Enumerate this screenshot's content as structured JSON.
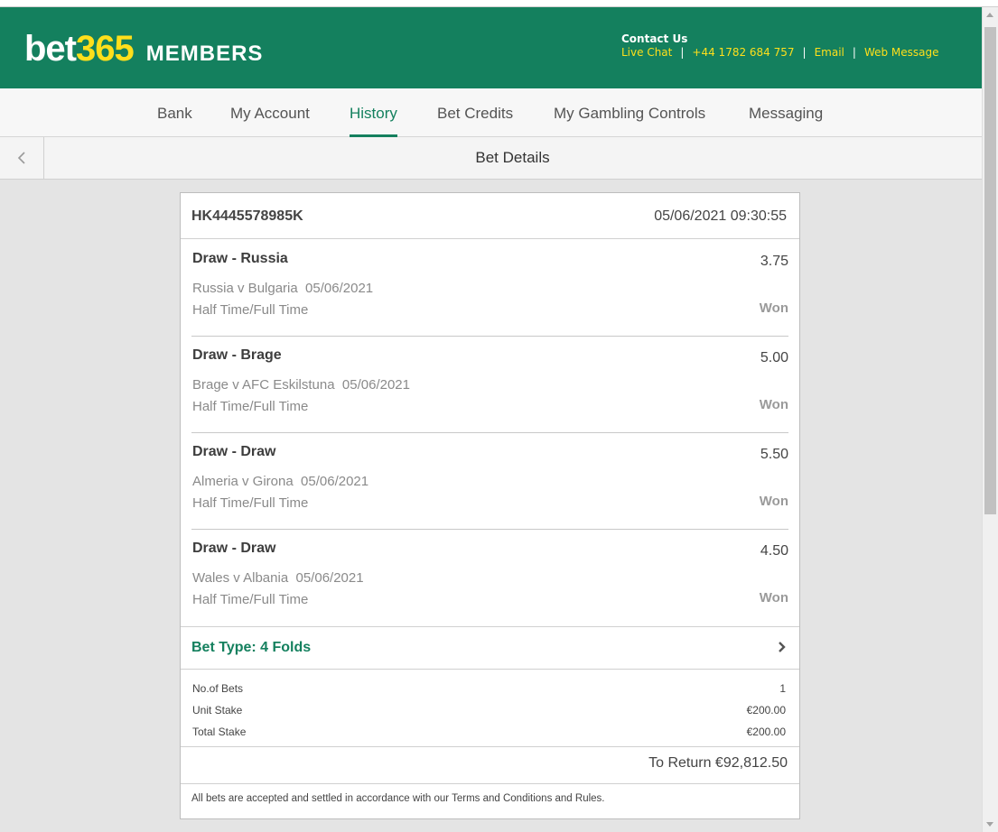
{
  "brand": {
    "logo_part1": "bet",
    "logo_part2": "365",
    "members": "MEMBERS"
  },
  "contact": {
    "title": "Contact Us",
    "live_chat": "Live Chat",
    "phone": "+44 1782 684 757",
    "email": "Email",
    "web_message": "Web Message",
    "separator": "|"
  },
  "nav": {
    "items": [
      {
        "label": "Bank"
      },
      {
        "label": "My Account"
      },
      {
        "label": "History",
        "active": true
      },
      {
        "label": "Bet Credits"
      },
      {
        "label": "My Gambling Controls"
      },
      {
        "label": "Messaging"
      }
    ]
  },
  "page": {
    "title": "Bet Details"
  },
  "bet": {
    "reference": "HK4445578985K",
    "datetime": "05/06/2021  09:30:55",
    "selections": [
      {
        "name": "Draw - Russia",
        "odds": "3.75",
        "event": "Russia v Bulgaria  05/06/2021",
        "market": "Half Time/Full Time",
        "result": "Won"
      },
      {
        "name": "Draw - Brage",
        "odds": "5.00",
        "event": "Brage v AFC Eskilstuna  05/06/2021",
        "market": "Half Time/Full Time",
        "result": "Won"
      },
      {
        "name": "Draw - Draw",
        "odds": "5.50",
        "event": "Almeria v Girona  05/06/2021",
        "market": "Half Time/Full Time",
        "result": "Won"
      },
      {
        "name": "Draw - Draw",
        "odds": "4.50",
        "event": "Wales v Albania  05/06/2021",
        "market": "Half Time/Full Time",
        "result": "Won"
      }
    ],
    "bet_type": "Bet Type: 4 Folds",
    "stakes": {
      "no_of_bets_label": "No.of Bets",
      "no_of_bets": "1",
      "unit_stake_label": "Unit Stake",
      "unit_stake": "€200.00",
      "total_stake_label": "Total Stake",
      "total_stake": "€200.00"
    },
    "to_return": "To Return €92,812.50",
    "terms": "All bets are accepted and settled in accordance with our Terms and Conditions and Rules."
  },
  "colors": {
    "brand_green": "#14805e",
    "brand_yellow": "#ffdf1b"
  },
  "icons": {
    "back": "chevron-left-icon",
    "bet_type": "chevron-right-icon"
  }
}
